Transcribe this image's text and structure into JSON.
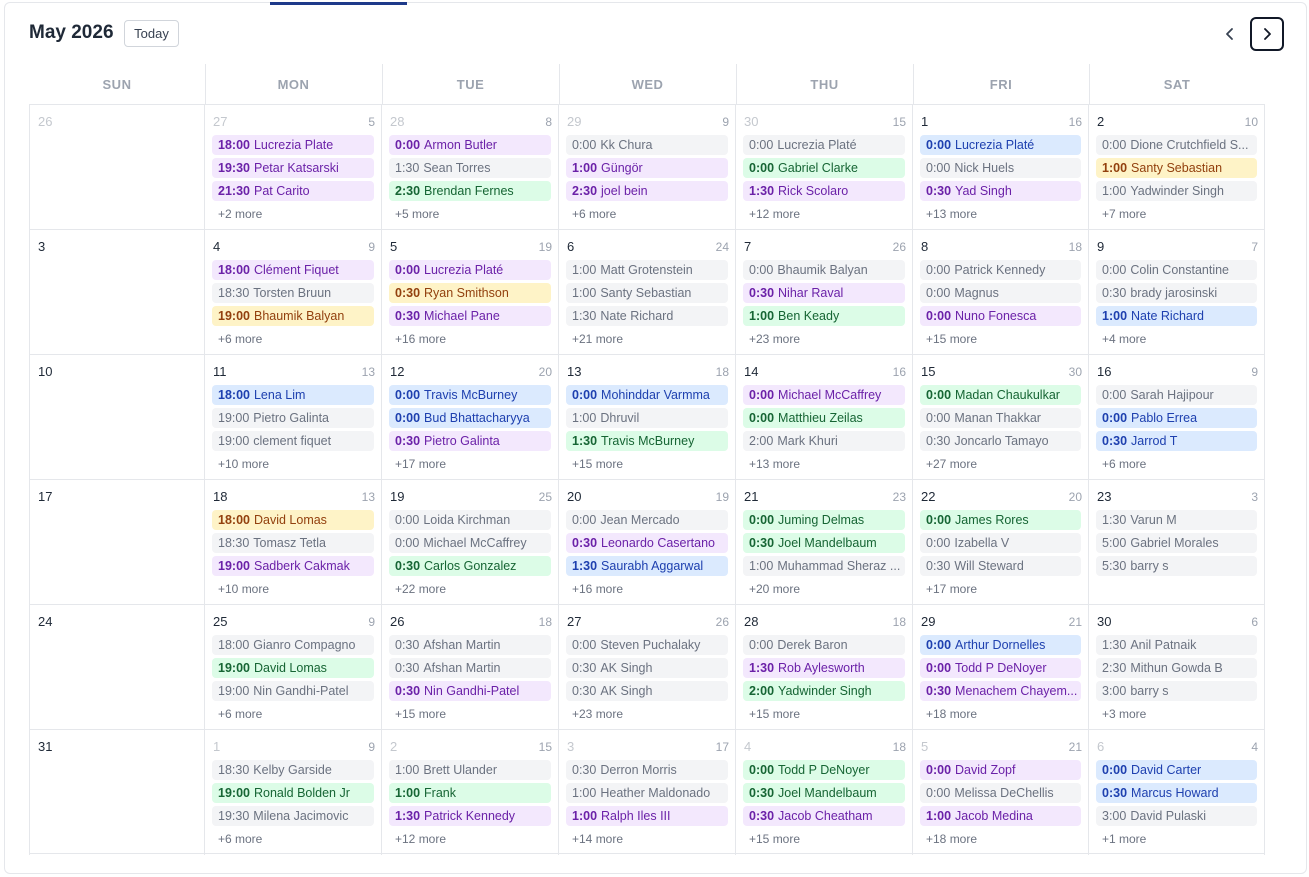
{
  "header": {
    "title": "May 2026",
    "today_label": "Today",
    "prev_icon": "chevron-left-icon",
    "next_icon": "chevron-right-icon"
  },
  "colors": {
    "gray": "#f3f4f6",
    "purple": "#f3e8fd",
    "green": "#dcfce7",
    "blue": "#dbeafe",
    "yellow": "#fef3c7",
    "accent": "#1e3a8a"
  },
  "weekdays": [
    "SUN",
    "MON",
    "TUE",
    "WED",
    "THU",
    "FRI",
    "SAT"
  ],
  "weeks": [
    [
      {
        "day": "26",
        "outside": true,
        "count": "",
        "events": [],
        "more": ""
      },
      {
        "day": "27",
        "outside": true,
        "count": "5",
        "events": [
          {
            "time": "18:00",
            "name": "Lucrezia Plate",
            "color": "purple"
          },
          {
            "time": "19:30",
            "name": "Petar Katsarski",
            "color": "purple"
          },
          {
            "time": "21:30",
            "name": "Pat Carito",
            "color": "purple"
          }
        ],
        "more": "+2 more"
      },
      {
        "day": "28",
        "outside": true,
        "count": "8",
        "events": [
          {
            "time": "0:00",
            "name": "Armon Butler",
            "color": "purple"
          },
          {
            "time": "1:30",
            "name": "Sean Torres",
            "color": "gray"
          },
          {
            "time": "2:30",
            "name": "Brendan Fernes",
            "color": "green"
          }
        ],
        "more": "+5 more"
      },
      {
        "day": "29",
        "outside": true,
        "count": "9",
        "events": [
          {
            "time": "0:00",
            "name": "Kk Chura",
            "color": "gray"
          },
          {
            "time": "1:00",
            "name": "Güngör",
            "color": "purple"
          },
          {
            "time": "2:30",
            "name": "joel bein",
            "color": "purple"
          }
        ],
        "more": "+6 more"
      },
      {
        "day": "30",
        "outside": true,
        "count": "15",
        "events": [
          {
            "time": "0:00",
            "name": "Lucrezia Platé",
            "color": "gray"
          },
          {
            "time": "0:00",
            "name": "Gabriel Clarke",
            "color": "green"
          },
          {
            "time": "1:30",
            "name": "Rick Scolaro",
            "color": "purple"
          }
        ],
        "more": "+12 more"
      },
      {
        "day": "1",
        "outside": false,
        "count": "16",
        "events": [
          {
            "time": "0:00",
            "name": "Lucrezia Platé",
            "color": "blue"
          },
          {
            "time": "0:00",
            "name": "Nick Huels",
            "color": "gray"
          },
          {
            "time": "0:30",
            "name": "Yad Singh",
            "color": "purple"
          }
        ],
        "more": "+13 more"
      },
      {
        "day": "2",
        "outside": false,
        "count": "10",
        "events": [
          {
            "time": "0:00",
            "name": "Dione Crutchfield S...",
            "color": "gray"
          },
          {
            "time": "1:00",
            "name": "Santy Sebastian",
            "color": "yellow"
          },
          {
            "time": "1:00",
            "name": "Yadwinder Singh",
            "color": "gray"
          }
        ],
        "more": "+7 more"
      }
    ],
    [
      {
        "day": "3",
        "outside": false,
        "count": "",
        "events": [],
        "more": ""
      },
      {
        "day": "4",
        "outside": false,
        "count": "9",
        "events": [
          {
            "time": "18:00",
            "name": "Clément Fiquet",
            "color": "purple"
          },
          {
            "time": "18:30",
            "name": "Torsten Bruun",
            "color": "gray"
          },
          {
            "time": "19:00",
            "name": "Bhaumik Balyan",
            "color": "yellow"
          }
        ],
        "more": "+6 more"
      },
      {
        "day": "5",
        "outside": false,
        "count": "19",
        "events": [
          {
            "time": "0:00",
            "name": "Lucrezia Platé",
            "color": "purple"
          },
          {
            "time": "0:30",
            "name": "Ryan Smithson",
            "color": "yellow"
          },
          {
            "time": "0:30",
            "name": "Michael Pane",
            "color": "purple"
          }
        ],
        "more": "+16 more"
      },
      {
        "day": "6",
        "outside": false,
        "count": "24",
        "events": [
          {
            "time": "1:00",
            "name": "Matt Grotenstein",
            "color": "gray"
          },
          {
            "time": "1:00",
            "name": "Santy Sebastian",
            "color": "gray"
          },
          {
            "time": "1:30",
            "name": "Nate Richard",
            "color": "gray"
          }
        ],
        "more": "+21 more"
      },
      {
        "day": "7",
        "outside": false,
        "count": "26",
        "events": [
          {
            "time": "0:00",
            "name": "Bhaumik Balyan",
            "color": "gray"
          },
          {
            "time": "0:30",
            "name": "Nihar Raval",
            "color": "purple"
          },
          {
            "time": "1:00",
            "name": "Ben Keady",
            "color": "green"
          }
        ],
        "more": "+23 more"
      },
      {
        "day": "8",
        "outside": false,
        "count": "18",
        "events": [
          {
            "time": "0:00",
            "name": "Patrick Kennedy",
            "color": "gray"
          },
          {
            "time": "0:00",
            "name": "Magnus",
            "color": "gray"
          },
          {
            "time": "0:00",
            "name": "Nuno Fonesca",
            "color": "purple"
          }
        ],
        "more": "+15 more"
      },
      {
        "day": "9",
        "outside": false,
        "count": "7",
        "events": [
          {
            "time": "0:00",
            "name": "Colin Constantine",
            "color": "gray"
          },
          {
            "time": "0:30",
            "name": "brady jarosinski",
            "color": "gray"
          },
          {
            "time": "1:00",
            "name": "Nate Richard",
            "color": "blue"
          }
        ],
        "more": "+4 more"
      }
    ],
    [
      {
        "day": "10",
        "outside": false,
        "count": "",
        "events": [],
        "more": ""
      },
      {
        "day": "11",
        "outside": false,
        "count": "13",
        "events": [
          {
            "time": "18:00",
            "name": "Lena Lim",
            "color": "blue"
          },
          {
            "time": "19:00",
            "name": "Pietro Galinta",
            "color": "gray"
          },
          {
            "time": "19:00",
            "name": "clement fiquet",
            "color": "gray"
          }
        ],
        "more": "+10 more"
      },
      {
        "day": "12",
        "outside": false,
        "count": "20",
        "events": [
          {
            "time": "0:00",
            "name": "Travis McBurney",
            "color": "blue"
          },
          {
            "time": "0:00",
            "name": "Bud Bhattacharyya",
            "color": "blue"
          },
          {
            "time": "0:30",
            "name": "Pietro Galinta",
            "color": "purple"
          }
        ],
        "more": "+17 more"
      },
      {
        "day": "13",
        "outside": false,
        "count": "18",
        "events": [
          {
            "time": "0:00",
            "name": "Mohinddar Varmma",
            "color": "blue"
          },
          {
            "time": "1:00",
            "name": "Dhruvil",
            "color": "gray"
          },
          {
            "time": "1:30",
            "name": "Travis McBurney",
            "color": "green"
          }
        ],
        "more": "+15 more"
      },
      {
        "day": "14",
        "outside": false,
        "count": "16",
        "events": [
          {
            "time": "0:00",
            "name": "Michael McCaffrey",
            "color": "purple"
          },
          {
            "time": "0:00",
            "name": "Matthieu Zeilas",
            "color": "green"
          },
          {
            "time": "2:00",
            "name": "Mark Khuri",
            "color": "gray"
          }
        ],
        "more": "+13 more"
      },
      {
        "day": "15",
        "outside": false,
        "count": "30",
        "events": [
          {
            "time": "0:00",
            "name": "Madan Chaukulkar",
            "color": "green"
          },
          {
            "time": "0:00",
            "name": "Manan Thakkar",
            "color": "gray"
          },
          {
            "time": "0:30",
            "name": "Joncarlo Tamayo",
            "color": "gray"
          }
        ],
        "more": "+27 more"
      },
      {
        "day": "16",
        "outside": false,
        "count": "9",
        "events": [
          {
            "time": "0:00",
            "name": "Sarah Hajipour",
            "color": "gray"
          },
          {
            "time": "0:00",
            "name": "Pablo Errea",
            "color": "blue"
          },
          {
            "time": "0:30",
            "name": "Jarrod T",
            "color": "blue"
          }
        ],
        "more": "+6 more"
      }
    ],
    [
      {
        "day": "17",
        "outside": false,
        "count": "",
        "events": [],
        "more": ""
      },
      {
        "day": "18",
        "outside": false,
        "count": "13",
        "events": [
          {
            "time": "18:00",
            "name": "David Lomas",
            "color": "yellow"
          },
          {
            "time": "18:30",
            "name": "Tomasz Tetla",
            "color": "gray"
          },
          {
            "time": "19:00",
            "name": "Sadberk Cakmak",
            "color": "purple"
          }
        ],
        "more": "+10 more"
      },
      {
        "day": "19",
        "outside": false,
        "count": "25",
        "events": [
          {
            "time": "0:00",
            "name": "Loida Kirchman",
            "color": "gray"
          },
          {
            "time": "0:00",
            "name": "Michael McCaffrey",
            "color": "gray"
          },
          {
            "time": "0:30",
            "name": "Carlos Gonzalez",
            "color": "green"
          }
        ],
        "more": "+22 more"
      },
      {
        "day": "20",
        "outside": false,
        "count": "19",
        "events": [
          {
            "time": "0:00",
            "name": "Jean Mercado",
            "color": "gray"
          },
          {
            "time": "0:30",
            "name": "Leonardo Casertano",
            "color": "purple"
          },
          {
            "time": "1:30",
            "name": "Saurabh Aggarwal",
            "color": "blue"
          }
        ],
        "more": "+16 more"
      },
      {
        "day": "21",
        "outside": false,
        "count": "23",
        "events": [
          {
            "time": "0:00",
            "name": "Juming Delmas",
            "color": "green"
          },
          {
            "time": "0:30",
            "name": "Joel Mandelbaum",
            "color": "green"
          },
          {
            "time": "1:00",
            "name": "Muhammad Sheraz ...",
            "color": "gray"
          }
        ],
        "more": "+20 more"
      },
      {
        "day": "22",
        "outside": false,
        "count": "20",
        "events": [
          {
            "time": "0:00",
            "name": "James Rores",
            "color": "green"
          },
          {
            "time": "0:00",
            "name": "Izabella V",
            "color": "gray"
          },
          {
            "time": "0:30",
            "name": "Will Steward",
            "color": "gray"
          }
        ],
        "more": "+17 more"
      },
      {
        "day": "23",
        "outside": false,
        "count": "3",
        "events": [
          {
            "time": "1:30",
            "name": "Varun M",
            "color": "gray"
          },
          {
            "time": "5:00",
            "name": "Gabriel Morales",
            "color": "gray"
          },
          {
            "time": "5:30",
            "name": "barry s",
            "color": "gray"
          }
        ],
        "more": ""
      }
    ],
    [
      {
        "day": "24",
        "outside": false,
        "count": "",
        "events": [],
        "more": ""
      },
      {
        "day": "25",
        "outside": false,
        "count": "9",
        "events": [
          {
            "time": "18:00",
            "name": "Gianro Compagno",
            "color": "gray"
          },
          {
            "time": "19:00",
            "name": "David Lomas",
            "color": "green"
          },
          {
            "time": "19:00",
            "name": "Nin Gandhi-Patel",
            "color": "gray"
          }
        ],
        "more": "+6 more"
      },
      {
        "day": "26",
        "outside": false,
        "count": "18",
        "events": [
          {
            "time": "0:30",
            "name": "Afshan Martin",
            "color": "gray"
          },
          {
            "time": "0:30",
            "name": "Afshan Martin",
            "color": "gray"
          },
          {
            "time": "0:30",
            "name": "Nin Gandhi-Patel",
            "color": "purple"
          }
        ],
        "more": "+15 more"
      },
      {
        "day": "27",
        "outside": false,
        "count": "26",
        "events": [
          {
            "time": "0:00",
            "name": "Steven Puchalaky",
            "color": "gray"
          },
          {
            "time": "0:30",
            "name": "AK Singh",
            "color": "gray"
          },
          {
            "time": "0:30",
            "name": "AK Singh",
            "color": "gray"
          }
        ],
        "more": "+23 more"
      },
      {
        "day": "28",
        "outside": false,
        "count": "18",
        "events": [
          {
            "time": "0:00",
            "name": "Derek Baron",
            "color": "gray"
          },
          {
            "time": "1:30",
            "name": "Rob Aylesworth",
            "color": "purple"
          },
          {
            "time": "2:00",
            "name": "Yadwinder Singh",
            "color": "green"
          }
        ],
        "more": "+15 more"
      },
      {
        "day": "29",
        "outside": false,
        "count": "21",
        "events": [
          {
            "time": "0:00",
            "name": "Arthur Dornelles",
            "color": "blue"
          },
          {
            "time": "0:00",
            "name": "Todd P DeNoyer",
            "color": "purple"
          },
          {
            "time": "0:30",
            "name": "Menachem Chayem...",
            "color": "purple"
          }
        ],
        "more": "+18 more"
      },
      {
        "day": "30",
        "outside": false,
        "count": "6",
        "events": [
          {
            "time": "1:30",
            "name": "Anil Patnaik",
            "color": "gray"
          },
          {
            "time": "2:30",
            "name": "Mithun Gowda B",
            "color": "gray"
          },
          {
            "time": "3:00",
            "name": "barry s",
            "color": "gray"
          }
        ],
        "more": "+3 more"
      }
    ],
    [
      {
        "day": "31",
        "outside": false,
        "count": "",
        "events": [],
        "more": ""
      },
      {
        "day": "1",
        "outside": true,
        "count": "9",
        "events": [
          {
            "time": "18:30",
            "name": "Kelby Garside",
            "color": "gray"
          },
          {
            "time": "19:00",
            "name": "Ronald Bolden Jr",
            "color": "green"
          },
          {
            "time": "19:30",
            "name": "Milena Jacimovic",
            "color": "gray"
          }
        ],
        "more": "+6 more"
      },
      {
        "day": "2",
        "outside": true,
        "count": "15",
        "events": [
          {
            "time": "1:00",
            "name": "Brett Ulander",
            "color": "gray"
          },
          {
            "time": "1:00",
            "name": "Frank",
            "color": "green"
          },
          {
            "time": "1:30",
            "name": "Patrick Kennedy",
            "color": "purple"
          }
        ],
        "more": "+12 more"
      },
      {
        "day": "3",
        "outside": true,
        "count": "17",
        "events": [
          {
            "time": "0:30",
            "name": "Derron Morris",
            "color": "gray"
          },
          {
            "time": "1:00",
            "name": "Heather Maldonado",
            "color": "gray"
          },
          {
            "time": "1:00",
            "name": "Ralph Iles III",
            "color": "purple"
          }
        ],
        "more": "+14 more"
      },
      {
        "day": "4",
        "outside": true,
        "count": "18",
        "events": [
          {
            "time": "0:00",
            "name": "Todd P DeNoyer",
            "color": "green"
          },
          {
            "time": "0:30",
            "name": "Joel Mandelbaum",
            "color": "green"
          },
          {
            "time": "0:30",
            "name": "Jacob Cheatham",
            "color": "purple"
          }
        ],
        "more": "+15 more"
      },
      {
        "day": "5",
        "outside": true,
        "count": "21",
        "events": [
          {
            "time": "0:00",
            "name": "David Zopf",
            "color": "purple"
          },
          {
            "time": "0:00",
            "name": "Melissa DeChellis",
            "color": "gray"
          },
          {
            "time": "1:00",
            "name": "Jacob Medina",
            "color": "purple"
          }
        ],
        "more": "+18 more"
      },
      {
        "day": "6",
        "outside": true,
        "count": "4",
        "events": [
          {
            "time": "0:00",
            "name": "David Carter",
            "color": "blue"
          },
          {
            "time": "0:30",
            "name": "Marcus Howard",
            "color": "blue"
          },
          {
            "time": "3:00",
            "name": "David Pulaski",
            "color": "gray"
          }
        ],
        "more": "+1 more"
      }
    ]
  ]
}
